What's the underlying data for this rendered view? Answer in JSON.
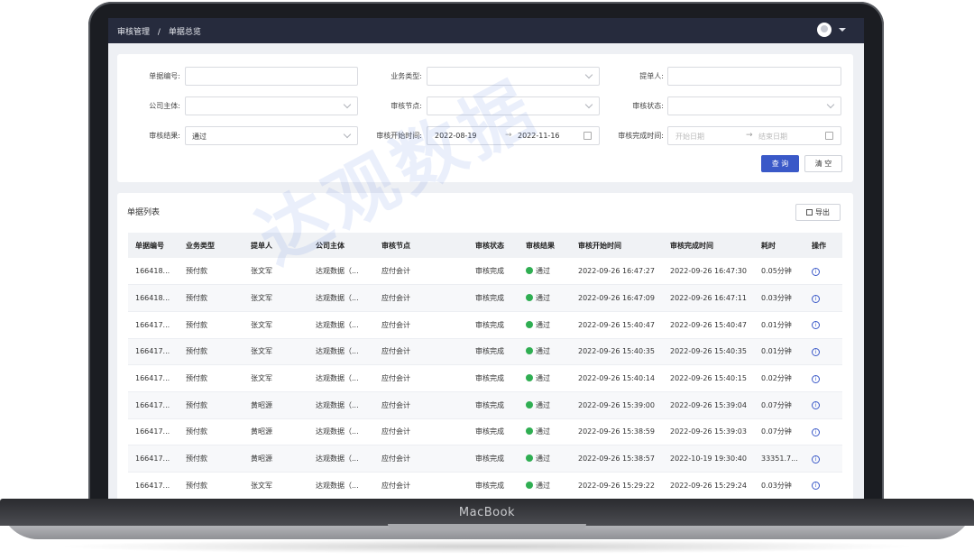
{
  "laptop": {
    "brand": "MacBook"
  },
  "header": {
    "breadcrumb": [
      "审核管理",
      "/",
      "单据总览"
    ]
  },
  "filters": {
    "doc_no_label": "单据编号:",
    "biz_type_label": "业务类型:",
    "submitter_label": "提单人:",
    "company_label": "公司主体:",
    "node_label": "审核节点:",
    "status_label": "审核状态:",
    "result_label": "审核结果:",
    "result_value": "通过",
    "start_time_label": "审核开始时间:",
    "start_from": "2022-08-19",
    "start_to": "2022-11-16",
    "end_time_label": "审核完成时间:",
    "end_from_placeholder": "开始日期",
    "end_to_placeholder": "结束日期",
    "query_button": "查 询",
    "clear_button": "清 空"
  },
  "list": {
    "title": "单据列表",
    "export_button": "导出",
    "columns": [
      "单据编号",
      "业务类型",
      "提单人",
      "公司主体",
      "审核节点",
      "审核状态",
      "审核结果",
      "审核开始时间",
      "审核完成时间",
      "耗时",
      "操作"
    ],
    "rows": [
      [
        "166418...",
        "预付款",
        "张文军",
        "达观数据（...",
        "应付会计",
        "审核完成",
        "通过",
        "2022-09-26 16:47:27",
        "2022-09-26 16:47:30",
        "0.05分钟"
      ],
      [
        "166418...",
        "预付款",
        "张文军",
        "达观数据（...",
        "应付会计",
        "审核完成",
        "通过",
        "2022-09-26 16:47:09",
        "2022-09-26 16:47:11",
        "0.03分钟"
      ],
      [
        "166417...",
        "预付款",
        "张文军",
        "达观数据（...",
        "应付会计",
        "审核完成",
        "通过",
        "2022-09-26 15:40:47",
        "2022-09-26 15:40:47",
        "0.01分钟"
      ],
      [
        "166417...",
        "预付款",
        "张文军",
        "达观数据（...",
        "应付会计",
        "审核完成",
        "通过",
        "2022-09-26 15:40:35",
        "2022-09-26 15:40:35",
        "0.01分钟"
      ],
      [
        "166417...",
        "预付款",
        "张文军",
        "达观数据（...",
        "应付会计",
        "审核完成",
        "通过",
        "2022-09-26 15:40:14",
        "2022-09-26 15:40:15",
        "0.02分钟"
      ],
      [
        "166417...",
        "预付款",
        "黄昭源",
        "达观数据（...",
        "应付会计",
        "审核完成",
        "通过",
        "2022-09-26 15:39:00",
        "2022-09-26 15:39:04",
        "0.07分钟"
      ],
      [
        "166417...",
        "预付款",
        "黄昭源",
        "达观数据（...",
        "应付会计",
        "审核完成",
        "通过",
        "2022-09-26 15:38:59",
        "2022-09-26 15:39:03",
        "0.07分钟"
      ],
      [
        "166417...",
        "预付款",
        "黄昭源",
        "达观数据（...",
        "应付会计",
        "审核完成",
        "通过",
        "2022-09-26 15:38:57",
        "2022-10-19 19:30:40",
        "33351.7..."
      ],
      [
        "166417...",
        "预付款",
        "张文军",
        "达观数据（...",
        "应付会计",
        "审核完成",
        "通过",
        "2022-09-26 15:29:22",
        "2022-09-26 15:29:24",
        "0.03分钟"
      ]
    ]
  },
  "watermark": "达观数据",
  "colors": {
    "accent": "#3a59c8",
    "topbar": "#262b3d",
    "success": "#2fae52"
  }
}
